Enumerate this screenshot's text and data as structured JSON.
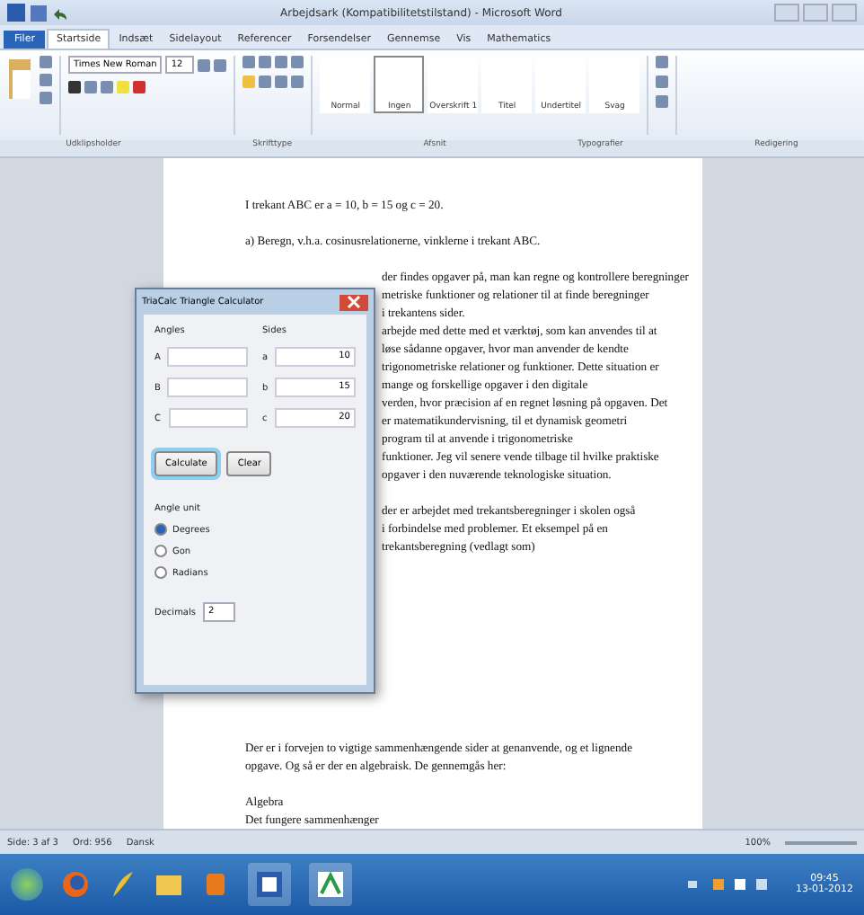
{
  "window": {
    "title": "Arbejdsark (Kompatibilitetstilstand) - Microsoft Word"
  },
  "ribbon_tabs": [
    {
      "label": "Filer",
      "selected": false,
      "kind": "file"
    },
    {
      "label": "Startside",
      "selected": true,
      "kind": "tab"
    },
    {
      "label": "Indsæt",
      "selected": false,
      "kind": "tab"
    },
    {
      "label": "Sidelayout",
      "selected": false,
      "kind": "tab"
    },
    {
      "label": "Referencer",
      "selected": false,
      "kind": "tab"
    },
    {
      "label": "Forsendelser",
      "selected": false,
      "kind": "tab"
    },
    {
      "label": "Gennemse",
      "selected": false,
      "kind": "tab"
    },
    {
      "label": "Vis",
      "selected": false,
      "kind": "tab"
    },
    {
      "label": "Mathematics",
      "selected": false,
      "kind": "tab"
    }
  ],
  "ribbon_groups": [
    "Udklipsholder",
    "Skrifttype",
    "Afsnit",
    "Typografier",
    "Redigering"
  ],
  "styles": [
    {
      "label": "Normal",
      "selected": false
    },
    {
      "label": "Ingen",
      "selected": true
    },
    {
      "label": "Overskrift 1",
      "selected": false
    },
    {
      "label": "Titel",
      "selected": false
    },
    {
      "label": "Undertitel",
      "selected": false
    },
    {
      "label": "Svag",
      "selected": false
    }
  ],
  "font": {
    "name": "Times New Roman",
    "size": "12"
  },
  "document": {
    "blocks": [
      {
        "kind": "full",
        "lines": [
          "I trekant ABC er a = 10, b = 15 og c = 20."
        ]
      },
      {
        "kind": "full",
        "lines": [
          "a)  Beregn, v.h.a. cosinusrelationerne, vinklerne i trekant ABC."
        ]
      },
      {
        "kind": "beside_dialog",
        "lines": [
          "der findes opgaver på, man kan regne og kontrollere beregninger",
          "metriske funktioner og relationer til at finde beregninger",
          "i trekantens sider.",
          "arbejde med dette med et værktøj, som kan anvendes til at",
          "løse sådanne opgaver, hvor man anvender de kendte",
          "trigonometriske relationer og funktioner. Dette situation er",
          "mange og forskellige opgaver i den digitale",
          "verden, hvor præcision af en regnet løsning på opgaven. Det",
          "er matematikundervisning, til et dynamisk geometri",
          "program til at anvende i trigonometriske",
          "funktioner. Jeg vil senere vende tilbage til hvilke praktiske",
          "opgaver i den nuværende teknologiske situation."
        ]
      },
      {
        "kind": "beside_dialog",
        "lines": [
          "der er arbejdet med trekantsberegninger i skolen også",
          "i forbindelse med problemer. Et eksempel på en",
          "trekantsberegning (vedlagt som)"
        ]
      },
      {
        "kind": "full",
        "lines": [
          "Der er i forvejen to vigtige sammenhængende sider at genanvende, og et lignende",
          "opgave. Og så er der en algebraisk. De gennemgås her:"
        ]
      },
      {
        "kind": "full",
        "lines": [
          "Algebra",
          "Det fungere sammenhænger"
        ]
      }
    ]
  },
  "dialog": {
    "title": "TriaCalc Triangle Calculator",
    "angles_label": "Angles",
    "sides_label": "Sides",
    "angles": [
      {
        "label": "A"
      },
      {
        "label": "B"
      },
      {
        "label": "C"
      }
    ],
    "sides": [
      {
        "label": "a",
        "value": "10"
      },
      {
        "label": "b",
        "value": "15"
      },
      {
        "label": "c",
        "value": "20"
      }
    ],
    "buttons": [
      {
        "label": "Calculate",
        "focused": true
      },
      {
        "label": "Clear",
        "focused": false
      }
    ],
    "angle_unit_label": "Angle unit",
    "units": [
      {
        "label": "Degrees",
        "selected": true
      },
      {
        "label": "Gon",
        "selected": false
      },
      {
        "label": "Radians",
        "selected": false
      }
    ],
    "decimals_label": "Decimals",
    "decimals": "2"
  },
  "status_bar": {
    "page": "Side: 3 af 3",
    "words": "Ord: 956",
    "language": "Dansk",
    "zoom": "100%"
  },
  "taskbar": {
    "time": "09:45",
    "date": "13-01-2012"
  }
}
